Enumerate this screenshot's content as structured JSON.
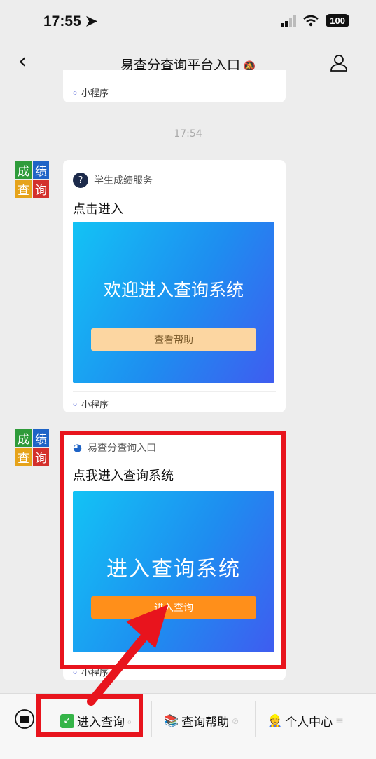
{
  "status": {
    "time": "17:55",
    "battery": "100"
  },
  "nav": {
    "title": "易查分查询平台入口"
  },
  "messages": {
    "top_card_footer": "小程序",
    "timestamp": "17:54",
    "card1": {
      "source": "学生成绩服务",
      "title": "点击进入",
      "banner_text": "欢迎进入查询系统",
      "button": "查看帮助",
      "footer": "小程序"
    },
    "card2": {
      "source": "易查分查询入口",
      "title": "点我进入查询系统",
      "banner_text": "进入查询系统",
      "button": "进入查询",
      "footer": "小程序"
    },
    "avatar": {
      "c1": "成",
      "c2": "绩",
      "c3": "查",
      "c4": "询",
      "colors": [
        "#2e9b3a",
        "#1e63c6",
        "#e6a31a",
        "#d3302c"
      ]
    }
  },
  "menu": {
    "item1": "进入查询",
    "item2": "查询帮助",
    "item3": "个人中心"
  },
  "colors": {
    "highlight": "#e8141d",
    "button_orange": "#ff8f1a",
    "button_peach": "#fcd6a1"
  }
}
